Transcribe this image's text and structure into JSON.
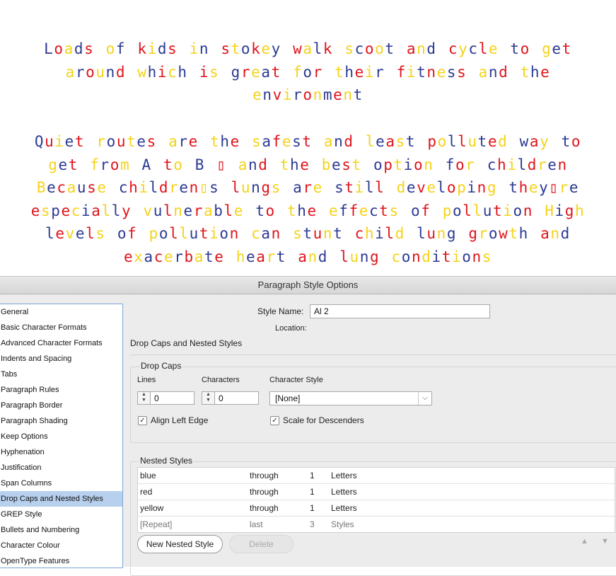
{
  "canvas": {
    "colors": [
      "#2c3a93",
      "#e0141c",
      "#f5d31a"
    ],
    "paragraph1": "Loads of kids in stokey walk  scoot and cycle to get around which is great for their fitness and the environment",
    "paragraph2": "Quiet routes are the safest and least polluted way to get from A to B ▯ and the best option for children  Because children▯s lungs are still developing  they▯re especially vulnerable to the effects of pollution  High levels of pollution can stunt child lung growth and exacerbate heart and lung conditions"
  },
  "dialog": {
    "title": "Paragraph Style Options",
    "categories": [
      "General",
      "Basic Character Formats",
      "Advanced Character Formats",
      "Indents and Spacing",
      "Tabs",
      "Paragraph Rules",
      "Paragraph Border",
      "Paragraph Shading",
      "Keep Options",
      "Hyphenation",
      "Justification",
      "Span Columns",
      "Drop Caps and Nested Styles",
      "GREP Style",
      "Bullets and Numbering",
      "Character Colour",
      "OpenType Features"
    ],
    "selected_category": "Drop Caps and Nested Styles",
    "style_name_label": "Style Name:",
    "style_name_value": "Al 2",
    "location_label": "Location:",
    "section_title": "Drop Caps and Nested Styles",
    "drop_caps": {
      "title": "Drop Caps",
      "lines_label": "Lines",
      "lines_value": "0",
      "characters_label": "Characters",
      "characters_value": "0",
      "char_style_label": "Character Style",
      "char_style_value": "[None]",
      "align_left_edge_label": "Align Left Edge",
      "align_left_edge_checked": true,
      "scale_descenders_label": "Scale for Descenders",
      "scale_descenders_checked": true
    },
    "nested_styles": {
      "title": "Nested Styles",
      "rows": [
        {
          "style": "blue",
          "mode": "through",
          "count": "1",
          "unit": "Letters"
        },
        {
          "style": "red",
          "mode": "through",
          "count": "1",
          "unit": "Letters"
        },
        {
          "style": "yellow",
          "mode": "through",
          "count": "1",
          "unit": "Letters"
        },
        {
          "style": "[Repeat]",
          "mode": "last",
          "count": "3",
          "unit": "Styles"
        }
      ],
      "new_button": "New Nested Style",
      "delete_button": "Delete",
      "up_icon": "triangle-up-icon",
      "down_icon": "triangle-down-icon"
    }
  }
}
